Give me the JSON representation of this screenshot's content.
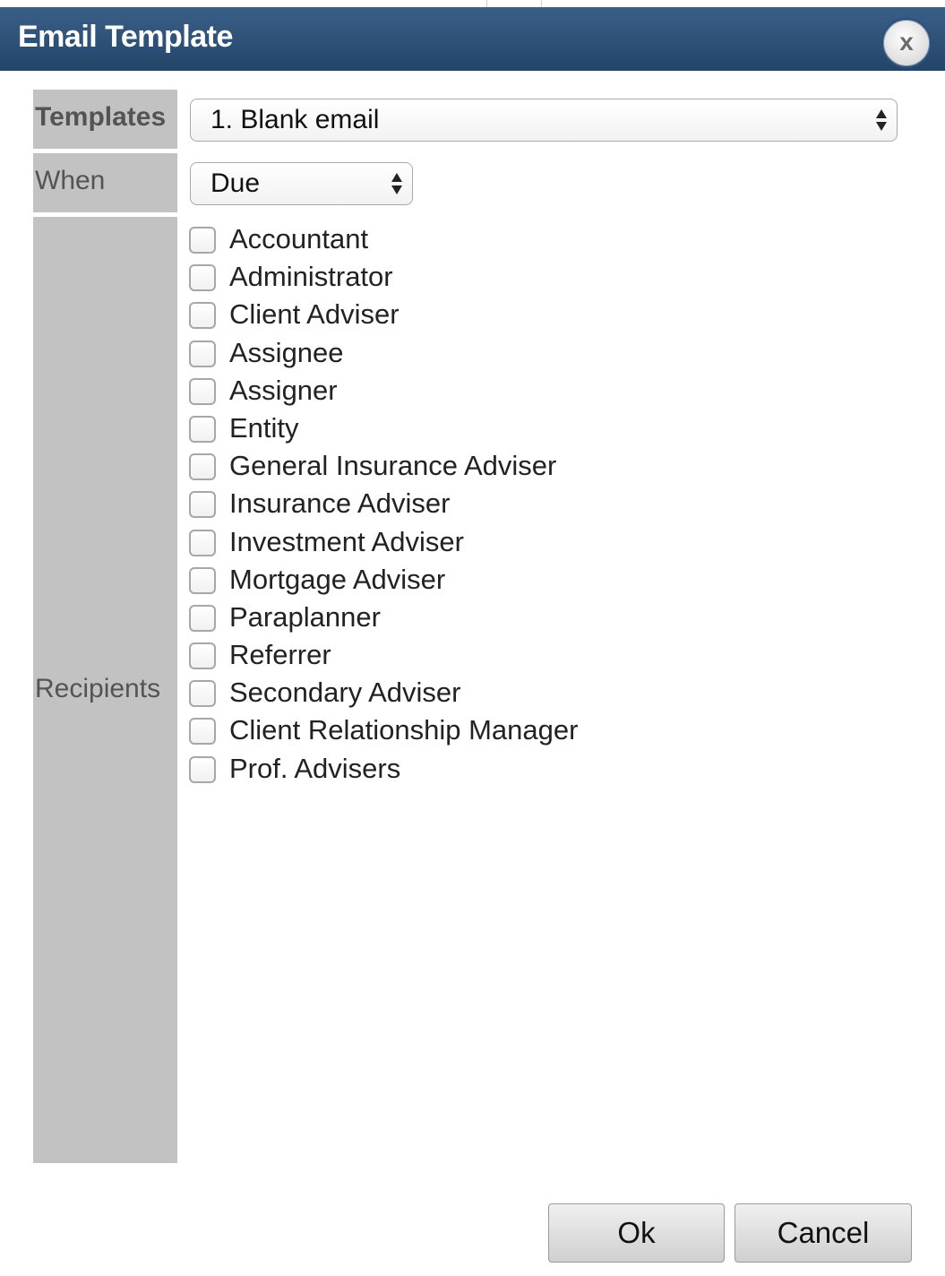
{
  "dialog": {
    "title": "Email Template",
    "close_label": "x"
  },
  "form": {
    "templates_label": "Templates",
    "templates_value": "1. Blank email",
    "when_label": "When",
    "when_value": "Due",
    "recipients_label": "Recipients"
  },
  "recipients": [
    {
      "label": "Accountant",
      "checked": false
    },
    {
      "label": "Administrator",
      "checked": false
    },
    {
      "label": "Client Adviser",
      "checked": false
    },
    {
      "label": "Assignee",
      "checked": false
    },
    {
      "label": "Assigner",
      "checked": false
    },
    {
      "label": "Entity",
      "checked": false
    },
    {
      "label": "General Insurance Adviser",
      "checked": false
    },
    {
      "label": "Insurance Adviser",
      "checked": false
    },
    {
      "label": "Investment Adviser",
      "checked": false
    },
    {
      "label": "Mortgage Adviser",
      "checked": false
    },
    {
      "label": "Paraplanner",
      "checked": false
    },
    {
      "label": "Referrer",
      "checked": false
    },
    {
      "label": "Secondary Adviser",
      "checked": false
    },
    {
      "label": "Client Relationship Manager",
      "checked": false
    },
    {
      "label": "Prof. Advisers",
      "checked": false
    }
  ],
  "buttons": {
    "ok_label": "Ok",
    "cancel_label": "Cancel"
  },
  "colors": {
    "titlebar": "#2d5078",
    "label_cell": "#c2c2c2"
  }
}
